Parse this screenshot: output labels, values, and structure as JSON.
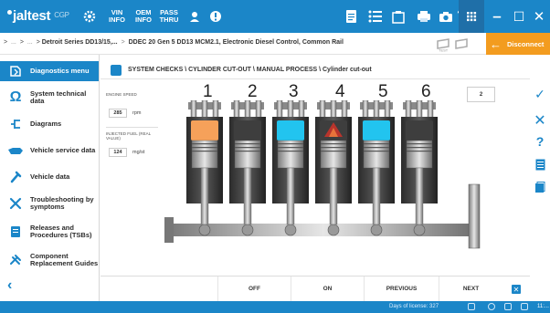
{
  "app": {
    "logo_main": "jaltest",
    "logo_suffix": "CGP",
    "toolbar": {
      "vin_line1": "VIN",
      "vin_line2": "INFO",
      "oem_line1": "OEM",
      "oem_line2": "INFO",
      "pass_line1": "PASS",
      "pass_line2": "THRU"
    },
    "window_controls": {
      "minimize": "–",
      "maximize": "☐",
      "close": "✕"
    }
  },
  "breadcrumb": {
    "part1": ">",
    "part2": "...",
    "part3": ">",
    "part4": "...",
    "part5": ">",
    "part6": "Detroit Series DD13/15,...",
    "part7": ">",
    "part8": "DDEC 20 Gen 5 DD13 MCM2.1, Electronic Diesel Control, Common Rail"
  },
  "disconnect_label": "Disconnect",
  "sidebar": {
    "header": "Diagnostics menu",
    "items": [
      {
        "label_line1": "System technical",
        "label_line2": "data"
      },
      {
        "label_line1": "Diagrams",
        "label_line2": ""
      },
      {
        "label_line1": "Vehicle service data",
        "label_line2": ""
      },
      {
        "label_line1": "Vehicle data",
        "label_line2": ""
      },
      {
        "label_line1": "Troubleshooting by",
        "label_line2": "symptoms"
      },
      {
        "label_line1": "Releases and",
        "label_line2": "Procedures (TSBs)"
      },
      {
        "label_line1": "Component",
        "label_line2": "Replacement Guides"
      }
    ]
  },
  "main": {
    "title": "SYSTEM CHECKS \\ CYLINDER CUT-OUT \\ MANUAL PROCESS \\ Cylinder cut-out",
    "engine_speed": {
      "label": "ENGINE SPEED",
      "value": "285",
      "unit": "rpm"
    },
    "injected_fuel": {
      "label": "INJECTED FUEL (REAL VALUE)",
      "value": "124",
      "unit": "mg/st"
    },
    "selected_cylinder": "2",
    "cylinders": [
      {
        "label": "1",
        "state": "orange"
      },
      {
        "label": "2",
        "state": "dark"
      },
      {
        "label": "3",
        "state": "cyan"
      },
      {
        "label": "4",
        "state": "combustion"
      },
      {
        "label": "5",
        "state": "cyan"
      },
      {
        "label": "6",
        "state": "dark"
      }
    ],
    "buttons": {
      "off": "OFF",
      "on": "ON",
      "previous": "PREVIOUS",
      "next": "NEXT"
    }
  },
  "status": {
    "license": "Days of license: 327",
    "clock": "11:..."
  },
  "colors": {
    "primary_blue": "#1b86c8",
    "disconnect_orange": "#f39c1f",
    "cyl_orange": "#f6a15a",
    "cyl_cyan": "#22c4ef",
    "cyl_dark": "#3e3e3e",
    "cyl_combustion": "#b8342c"
  }
}
